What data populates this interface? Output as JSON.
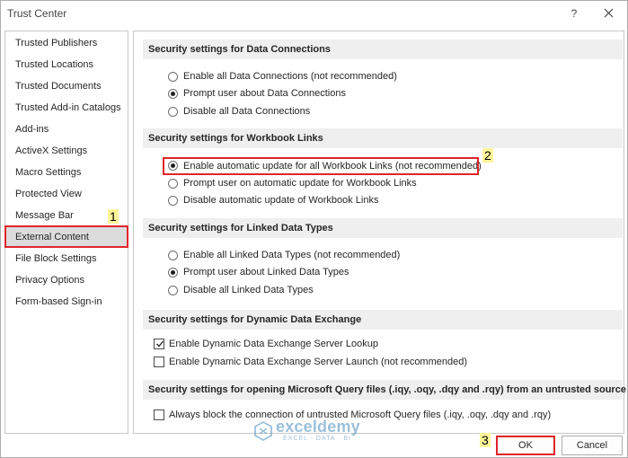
{
  "window": {
    "title": "Trust Center",
    "help_label": "?"
  },
  "sidebar": {
    "items": [
      {
        "label": "Trusted Publishers"
      },
      {
        "label": "Trusted Locations"
      },
      {
        "label": "Trusted Documents"
      },
      {
        "label": "Trusted Add-in Catalogs"
      },
      {
        "label": "Add-ins"
      },
      {
        "label": "ActiveX Settings"
      },
      {
        "label": "Macro Settings"
      },
      {
        "label": "Protected View"
      },
      {
        "label": "Message Bar"
      },
      {
        "label": "External Content",
        "selected": true
      },
      {
        "label": "File Block Settings"
      },
      {
        "label": "Privacy Options"
      },
      {
        "label": "Form-based Sign-in"
      }
    ]
  },
  "sections": {
    "data_connections": {
      "header": "Security settings for Data Connections",
      "options": [
        {
          "label": "Enable all Data Connections (not recommended)",
          "checked": false
        },
        {
          "label": "Prompt user about Data Connections",
          "checked": true
        },
        {
          "label": "Disable all Data Connections",
          "checked": false
        }
      ]
    },
    "workbook_links": {
      "header": "Security settings for Workbook Links",
      "options": [
        {
          "label": "Enable automatic update for all Workbook Links (not recommended)",
          "checked": true
        },
        {
          "label": "Prompt user on automatic update for Workbook Links",
          "checked": false
        },
        {
          "label": "Disable automatic update of Workbook Links",
          "checked": false
        }
      ]
    },
    "linked_data_types": {
      "header": "Security settings for Linked Data Types",
      "options": [
        {
          "label": "Enable all Linked Data Types (not recommended)",
          "checked": false
        },
        {
          "label": "Prompt user about Linked Data Types",
          "checked": true
        },
        {
          "label": "Disable all Linked Data Types",
          "checked": false
        }
      ]
    },
    "dde": {
      "header": "Security settings for Dynamic Data Exchange",
      "options": [
        {
          "label": "Enable Dynamic Data Exchange Server Lookup",
          "checked": true
        },
        {
          "label": "Enable Dynamic Data Exchange Server Launch (not recommended)",
          "checked": false
        }
      ]
    },
    "query_files": {
      "header": "Security settings for opening  Microsoft Query files (.iqy, .oqy, .dqy and .rqy) from an untrusted source",
      "options": [
        {
          "label": "Always block the connection of untrusted Microsoft Query files (.iqy, .oqy, .dqy and .rqy)",
          "checked": false
        }
      ]
    }
  },
  "annotations": {
    "step1": "1",
    "step2": "2",
    "step3": "3"
  },
  "watermark": {
    "name": "exceldemy",
    "tagline": "EXCEL · DATA · BI"
  },
  "buttons": {
    "ok": "OK",
    "cancel": "Cancel"
  },
  "colors": {
    "highlight_red": "#e0242b",
    "badge_yellow": "#fff59a",
    "selected_bg": "#dcdcdc",
    "header_bg": "#efefef"
  }
}
